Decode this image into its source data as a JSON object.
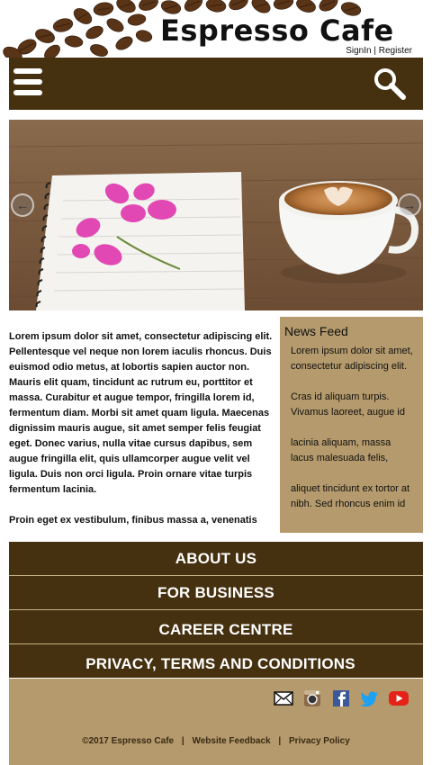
{
  "header": {
    "brand": "Espresso Cafe",
    "signin": "SignIn",
    "divider": "|",
    "register": "Register"
  },
  "hero": {
    "prev": "←",
    "next": "→"
  },
  "article": {
    "paragraphs": [
      "Lorem ipsum dolor sit amet, consectetur adipiscing elit. Pellentesque vel neque non lorem iaculis rhoncus. Duis euismod odio metus, at lobortis sapien auctor non. Mauris elit quam, tincidunt ac rutrum eu, porttitor et massa. Curabitur et augue tempor, fringilla lorem id, fermentum diam. Morbi sit amet quam ligula. Maecenas dignissim mauris augue, sit amet semper felis feugiat eget. Donec varius, nulla vitae cursus dapibus, sem augue fringilla elit, quis ullamcorper augue velit vel ligula. Duis non orci ligula. Proin ornare vitae turpis fermentum lacinia.",
      "Proin eget ex vestibulum, finibus massa a, venenatis"
    ]
  },
  "news": {
    "title": "News Feed",
    "items": [
      "Lorem ipsum dolor sit amet, consectetur adipiscing elit.",
      "Cras id aliquam turpis. Vivamus laoreet, augue id",
      "lacinia aliquam, massa lacus malesuada felis,",
      "aliquet tincidunt ex tortor at nibh. Sed rhoncus enim id"
    ]
  },
  "footnav": {
    "about": "ABOUT US",
    "business": "FOR BUSINESS",
    "career": "CAREER CENTRE",
    "privacy_terms": "PRIVACY, TERMS AND CONDITIONS"
  },
  "footer": {
    "copyright": "©2017 Espresso Cafe",
    "sep": "|",
    "feedback": "Website Feedback",
    "policy": "Privacy Policy",
    "social": [
      "mail-icon",
      "instagram-icon",
      "facebook-icon",
      "twitter-icon",
      "youtube-icon"
    ]
  },
  "colors": {
    "nav_brown": "#45300f",
    "tan": "#b49a6c",
    "divider": "#c8b48a"
  }
}
